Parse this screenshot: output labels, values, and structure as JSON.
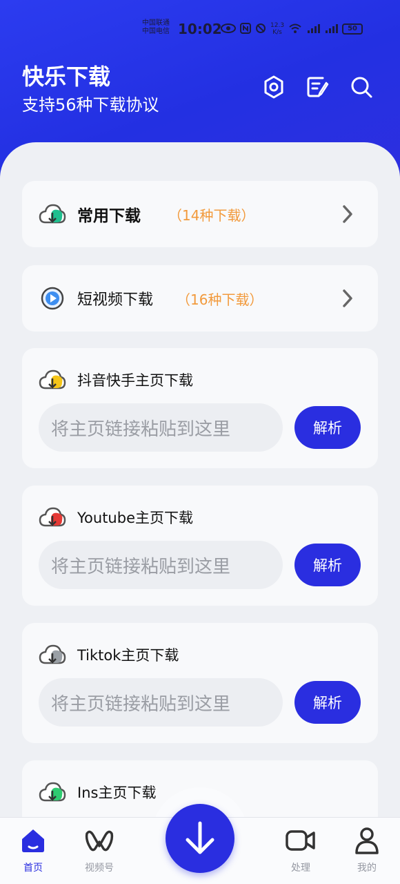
{
  "status_bar": {
    "carrier_1": "中国联通",
    "carrier_2": "中国电信",
    "time": "10:02",
    "speed_value": "12.3",
    "speed_unit": "K/s",
    "battery": "50"
  },
  "header": {
    "title": "快乐下载",
    "subtitle": "支持56种下载协议",
    "icons": [
      "settings-icon",
      "notes-icon",
      "search-icon"
    ]
  },
  "cards": {
    "common": {
      "label": "常用下载",
      "count": "（14种下载）"
    },
    "short_video": {
      "label": "短视频下载",
      "count": "（16种下载）"
    },
    "douyin": {
      "label": "抖音快手主页下载",
      "placeholder": "将主页链接粘贴到这里",
      "button": "解析"
    },
    "youtube": {
      "label": "Youtube主页下载",
      "placeholder": "将主页链接粘贴到这里",
      "button": "解析"
    },
    "tiktok": {
      "label": "Tiktok主页下载",
      "placeholder": "将主页链接粘贴到这里",
      "button": "解析"
    },
    "ins": {
      "label": "Ins主页下载"
    }
  },
  "bottom_nav": {
    "home": "首页",
    "channels": "视频号",
    "process": "处理",
    "mine": "我的"
  },
  "colors": {
    "accent": "#2a2ee0",
    "count_orange": "#f29a3c",
    "douyin_cloud": "#f5c518",
    "youtube_cloud": "#e53935",
    "tiktok_cloud": "#9aa0a6",
    "ins_cloud": "#2ecc71",
    "common_cloud": "#1fbf8f"
  }
}
